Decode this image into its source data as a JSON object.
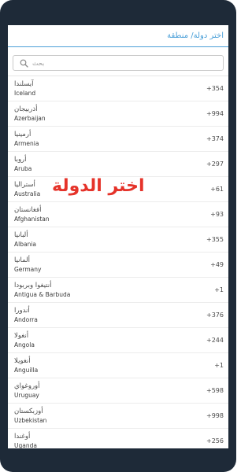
{
  "header": {
    "title": "اختر دولة/ منطقة"
  },
  "search": {
    "placeholder": "بحث",
    "icon": "search-icon"
  },
  "overlay": {
    "text": "اختر الدولة",
    "color": "#e5332a"
  },
  "accent_color": "#4a9fd8",
  "countries": [
    {
      "ar": "آيسلندا",
      "en": "Iceland",
      "code": "+354"
    },
    {
      "ar": "أذربيجان",
      "en": "Azerbaijan",
      "code": "+994"
    },
    {
      "ar": "أرمينيا",
      "en": "Armenia",
      "code": "+374"
    },
    {
      "ar": "أروبا",
      "en": "Aruba",
      "code": "+297"
    },
    {
      "ar": "أستراليا",
      "en": "Australia",
      "code": "+61"
    },
    {
      "ar": "أفغانستان",
      "en": "Afghanistan",
      "code": "+93"
    },
    {
      "ar": "ألبانيا",
      "en": "Albania",
      "code": "+355"
    },
    {
      "ar": "ألمانيا",
      "en": "Germany",
      "code": "+49"
    },
    {
      "ar": "أنتيغوا وبربودا",
      "en": "Antigua & Barbuda",
      "code": "+1"
    },
    {
      "ar": "أندورا",
      "en": "Andorra",
      "code": "+376"
    },
    {
      "ar": "أنغولا",
      "en": "Angola",
      "code": "+244"
    },
    {
      "ar": "أنغويلا",
      "en": "Anguilla",
      "code": "+1"
    },
    {
      "ar": "أوروغواي",
      "en": "Uruguay",
      "code": "+598"
    },
    {
      "ar": "أوزبكستان",
      "en": "Uzbekistan",
      "code": "+998"
    },
    {
      "ar": "أوغندا",
      "en": "Uganda",
      "code": "+256"
    }
  ]
}
